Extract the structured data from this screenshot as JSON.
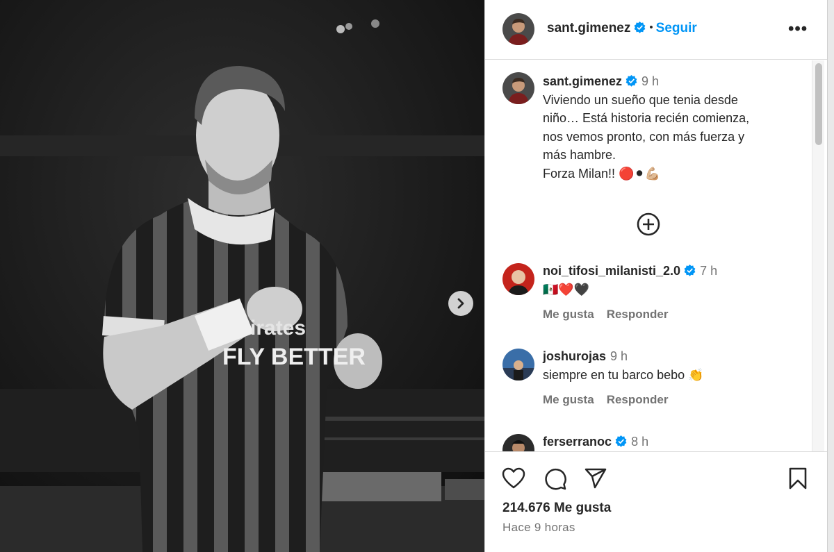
{
  "post": {
    "author": "sant.gimenez",
    "follow_label": "Seguir",
    "more_label": "•••",
    "caption_time": "9 h",
    "caption_lines": [
      "Viviendo un sueño que tenia desde",
      "niño… Está historia recién comienza,",
      "nos vemos pronto, con más fuerza y",
      "más hambre.",
      "Forza Milan!! 🔴⚫💪🏼"
    ]
  },
  "comments": [
    {
      "user": "noi_tifosi_milanisti_2.0",
      "verified": true,
      "time": "7 h",
      "text": "🇲🇽❤️🖤",
      "like_label": "Me gusta",
      "reply_label": "Responder"
    },
    {
      "user": "joshurojas",
      "verified": false,
      "time": "9 h",
      "text": "siempre en tu barco bebo 👏",
      "like_label": "Me gusta",
      "reply_label": "Responder"
    },
    {
      "user": "ferserranoc",
      "verified": true,
      "time": "8 h"
    }
  ],
  "footer": {
    "likes": "214.676 Me gusta",
    "posted_ago": "Hace 9 horas"
  },
  "colors": {
    "accent": "#0095f6",
    "verified": "#0095f6",
    "muted": "#737373"
  },
  "icons": [
    "heart-icon",
    "comment-icon",
    "share-icon",
    "bookmark-icon",
    "plus-circle-icon",
    "chevron-right-icon",
    "verified-icon"
  ]
}
